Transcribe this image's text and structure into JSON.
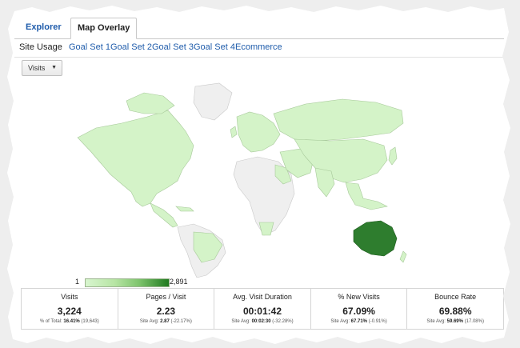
{
  "tabs": [
    {
      "label": "Explorer",
      "active": false
    },
    {
      "label": "Map Overlay",
      "active": true
    }
  ],
  "subnav": [
    "Site Usage",
    "Goal Set 1",
    "Goal Set 2",
    "Goal Set 3",
    "Goal Set 4",
    "Ecommerce"
  ],
  "metric_selector": {
    "selected": "Visits"
  },
  "icons": {
    "dropdown": "chevron-down-icon"
  },
  "colors": {
    "link": "#1f5cab",
    "map_low": "#d8f5cf",
    "map_high": "#1f7a1f",
    "map_nodata": "#efefef"
  },
  "legend": {
    "min": "1",
    "max": "2,891"
  },
  "metrics": [
    {
      "label": "Visits",
      "value": "3,224",
      "sub_prefix": "% of Total: ",
      "sub_bold": "16.41%",
      "sub_suffix": " (19,643)"
    },
    {
      "label": "Pages / Visit",
      "value": "2.23",
      "sub_prefix": "Site Avg: ",
      "sub_bold": "2.87",
      "sub_suffix": " (-22.17%)"
    },
    {
      "label": "Avg. Visit Duration",
      "value": "00:01:42",
      "sub_prefix": "Site Avg: ",
      "sub_bold": "00:02:30",
      "sub_suffix": " (-32.28%)"
    },
    {
      "label": "% New Visits",
      "value": "67.09%",
      "sub_prefix": "Site Avg: ",
      "sub_bold": "67.71%",
      "sub_suffix": " (-0.91%)"
    },
    {
      "label": "Bounce Rate",
      "value": "69.88%",
      "sub_prefix": "Site Avg: ",
      "sub_bold": "59.69%",
      "sub_suffix": " (17.08%)"
    }
  ]
}
